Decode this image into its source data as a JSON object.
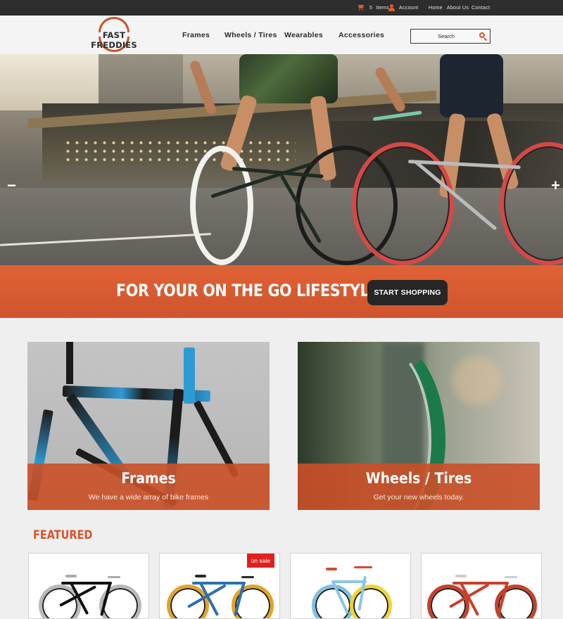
{
  "topbar": {
    "cart_count": "5",
    "cart_label": "Items",
    "account_label": "Account",
    "links": [
      "Home",
      "About Us",
      "Contact"
    ]
  },
  "logo": {
    "name": "FAST FREDDIES"
  },
  "nav": {
    "items": [
      "Frames",
      "Wheels / Tires",
      "Wearables",
      "Accessories"
    ]
  },
  "search": {
    "placeholder": "Search"
  },
  "hero": {
    "prev_arrow": "−",
    "next_arrow": "+",
    "tagline": "FOR YOUR ON THE GO LIFESTYLE",
    "cta_label": "START SHOPPING"
  },
  "categories": [
    {
      "title": "Frames",
      "subtitle": "We have a wide array of bike frames"
    },
    {
      "title": "Wheels / Tires",
      "subtitle": "Get your new wheels today."
    }
  ],
  "featured": {
    "title": "FEATURED",
    "sale_badge": "on sale"
  },
  "colors": {
    "accent": "#d9532b",
    "banner": "#df592a",
    "topbar": "#2d2d2d",
    "sale": "#e0201f"
  }
}
